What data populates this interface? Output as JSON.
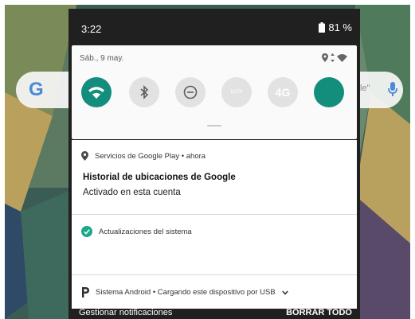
{
  "status_bar": {
    "time": "3:22",
    "battery": "81 %",
    "battery_icon": "battery-icon"
  },
  "quick_settings": {
    "date": "Sáb., 9 may.",
    "status_icons": [
      "location-icon",
      "data-transfer-icon",
      "wifi-signal-icon"
    ],
    "tiles": [
      {
        "name": "wifi",
        "icon": "wifi-icon",
        "state": "on"
      },
      {
        "name": "bluetooth",
        "icon": "bluetooth-icon",
        "state": "off"
      },
      {
        "name": "do-not-disturb",
        "icon": "do-not-disturb-icon",
        "state": "off"
      },
      {
        "name": "mobile-data",
        "icon": "mobile-data-icon",
        "state": "off",
        "label": "DATA"
      },
      {
        "name": "4g",
        "icon": "4g-icon",
        "state": "off",
        "label": "4G"
      },
      {
        "name": "extra",
        "icon": "tile-icon",
        "state": "on"
      }
    ]
  },
  "notifications": [
    {
      "app": "Servicios de Google Play",
      "time": "ahora",
      "icon": "location-pin-icon",
      "title": "Historial de ubicaciones de Google",
      "text": "Activado en esta cuenta"
    },
    {
      "app": "Actualizaciones del sistema",
      "icon": "system-update-icon"
    },
    {
      "app": "Sistema Android",
      "text": "Cargando este dispositivo por USB",
      "icon": "android-system-icon"
    }
  ],
  "home": {
    "search_logo": "G",
    "search_hint": "le\""
  },
  "footer": {
    "manage": "Gestionar notificaciones",
    "clear_all": "BORRAR TODO"
  },
  "colors": {
    "accent": "#138e7c",
    "shade_background": "#202020",
    "panel_background": "#fafafa"
  }
}
